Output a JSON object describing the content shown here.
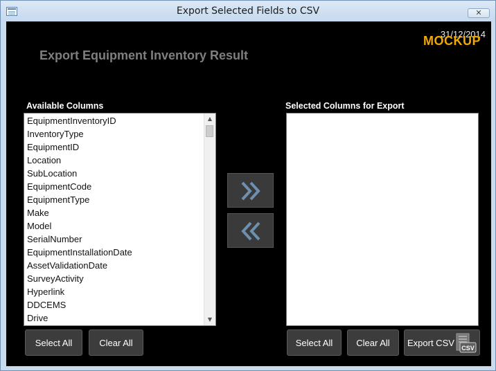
{
  "window": {
    "title": "Export Selected Fields to CSV",
    "close_symbol": "✕"
  },
  "header": {
    "date": "31/12/2014",
    "watermark": "MOCKUP",
    "form_title": "Export Equipment Inventory Result"
  },
  "available": {
    "label": "Available Columns",
    "items": [
      "EquipmentInventoryID",
      "InventoryType",
      "EquipmentID",
      "Location",
      "SubLocation",
      "EquipmentCode",
      "EquipmentType",
      "Make",
      "Model",
      "SerialNumber",
      "EquipmentInstallationDate",
      "AssetValidationDate",
      "SurveyActivity",
      "Hyperlink",
      "DDCEMS",
      "Drive"
    ]
  },
  "selected": {
    "label": "Selected Columns for Export",
    "items": []
  },
  "buttons": {
    "select_all_left": "Select All",
    "clear_all_left": "Clear All",
    "select_all_right": "Select All",
    "clear_all_right": "Clear All",
    "export_csv": "Export CSV",
    "csv_icon_text": "CSV"
  },
  "icons": {
    "move_right": "double-chevron-right-icon",
    "move_left": "double-chevron-left-icon",
    "csv_file": "csv-file-icon"
  },
  "colors": {
    "client_bg": "#000000",
    "watermark": "#f2a900",
    "form_title": "#7f7f7f",
    "chevron": "#6e8fb0"
  }
}
